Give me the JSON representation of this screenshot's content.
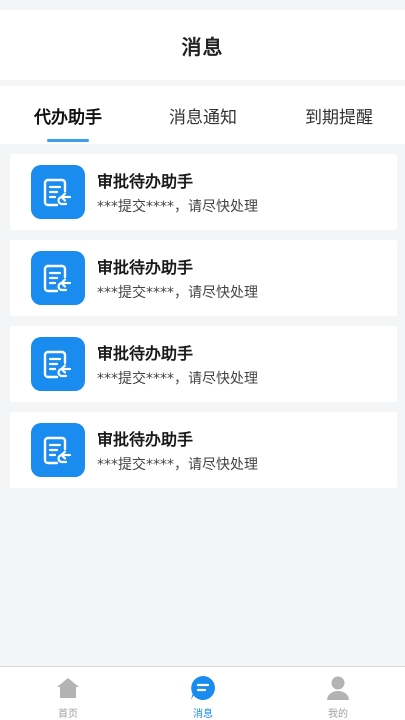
{
  "header": {
    "title": "消息"
  },
  "tabs": [
    {
      "label": "代办助手",
      "active": true
    },
    {
      "label": "消息通知",
      "active": false
    },
    {
      "label": "到期提醒",
      "active": false
    }
  ],
  "messages": [
    {
      "icon": "document-return-icon",
      "title": "审批待办助手",
      "desc": "***提交****，请尽快处理"
    },
    {
      "icon": "document-return-icon",
      "title": "审批待办助手",
      "desc": "***提交****，请尽快处理"
    },
    {
      "icon": "document-return-icon",
      "title": "审批待办助手",
      "desc": "***提交****，请尽快处理"
    },
    {
      "icon": "document-return-icon",
      "title": "审批待办助手",
      "desc": "***提交****，请尽快处理"
    }
  ],
  "tabbar": [
    {
      "label": "首页",
      "icon": "home-icon",
      "active": false
    },
    {
      "label": "消息",
      "icon": "message-icon",
      "active": true
    },
    {
      "label": "我的",
      "icon": "user-icon",
      "active": false
    }
  ],
  "colors": {
    "accent": "#1a8cf0",
    "underline": "#3aa0ee",
    "inactive": "#a0a0a0",
    "background": "#f4f5f7"
  }
}
